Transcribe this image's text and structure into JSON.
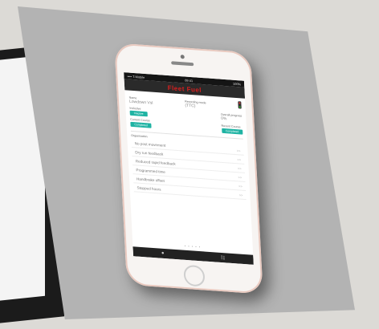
{
  "status": {
    "left": "•••• T-Mobile",
    "center": "09:41",
    "right": "100%"
  },
  "app": {
    "title": "Fleet Fuel"
  },
  "vehicle": {
    "name_label": "Name",
    "name_value": "Lowdown Vsl",
    "recording_label": "Recording mode",
    "recording_value": "(TTC)",
    "status_label": "Inclusive",
    "status_value": "Inactive",
    "progress_label": "Overall progress",
    "progress_value": "0%",
    "current_label": "Current Course",
    "current_value": "Completed",
    "recent_label": "Recent Course",
    "recent_value": "Completed"
  },
  "organisation": {
    "label": "Organisation",
    "items": [
      {
        "label": "No post movement",
        "arrow": ">>"
      },
      {
        "label": "Dry run feedback",
        "arrow": ">>"
      },
      {
        "label": "Reduced rapid feedback",
        "arrow": ">>"
      },
      {
        "label": "Programmed time",
        "arrow": ">>"
      },
      {
        "label": "Handbrake offset",
        "arrow": ">>"
      },
      {
        "label": "Stopped hours",
        "arrow": ">>"
      }
    ]
  },
  "pager": {
    "dots": "• • • • •"
  },
  "bottom_nav": {
    "left_icon": "home-icon",
    "right_icon": "grid-icon",
    "left": "●",
    "right": "☷"
  }
}
